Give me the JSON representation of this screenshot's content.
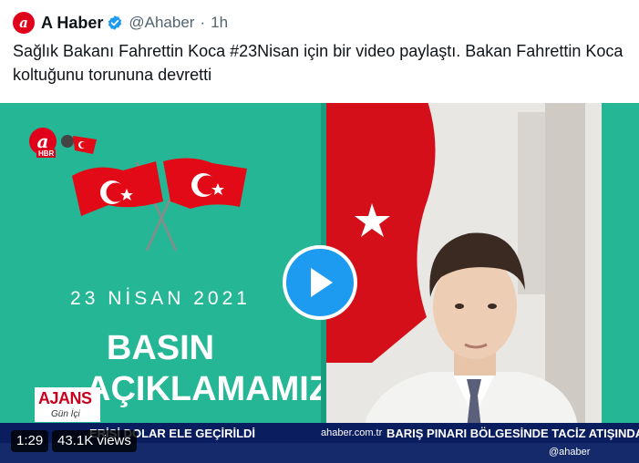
{
  "tweet": {
    "author_name": "A Haber",
    "handle": "@Ahaber",
    "separator": "·",
    "time": "1h",
    "text": "Sağlık Bakanı Fahrettin Koca #23Nisan için bir video paylaştı. Bakan Fahrettin Koca koltuğunu torununa devretti",
    "avatar_letter": "a"
  },
  "video": {
    "logo_text": "HBR",
    "date_text": "23 NİSAN 2021",
    "headline_1": "BASIN",
    "headline_2": "AÇIKLAMAMIZ",
    "program_name": "AJANS",
    "program_sub": "Gün İçi",
    "ticker_left": "ERİSİ DOLAR ELE GEÇİRİLDİ",
    "ticker_site": "ahaber.com.tr",
    "ticker_right": "BARIŞ PINARI BÖLGESİNDE TACİZ ATIŞINDA BULUNA",
    "ticker_handle": "@ahaber",
    "duration": "1:29",
    "views": "43.1K views"
  },
  "colors": {
    "brand_red": "#e0001b",
    "twitter_blue": "#1d9bf0",
    "video_green": "#25b795"
  },
  "icons": [
    "verified-badge-icon",
    "play-icon",
    "turkish-flag-icon"
  ]
}
